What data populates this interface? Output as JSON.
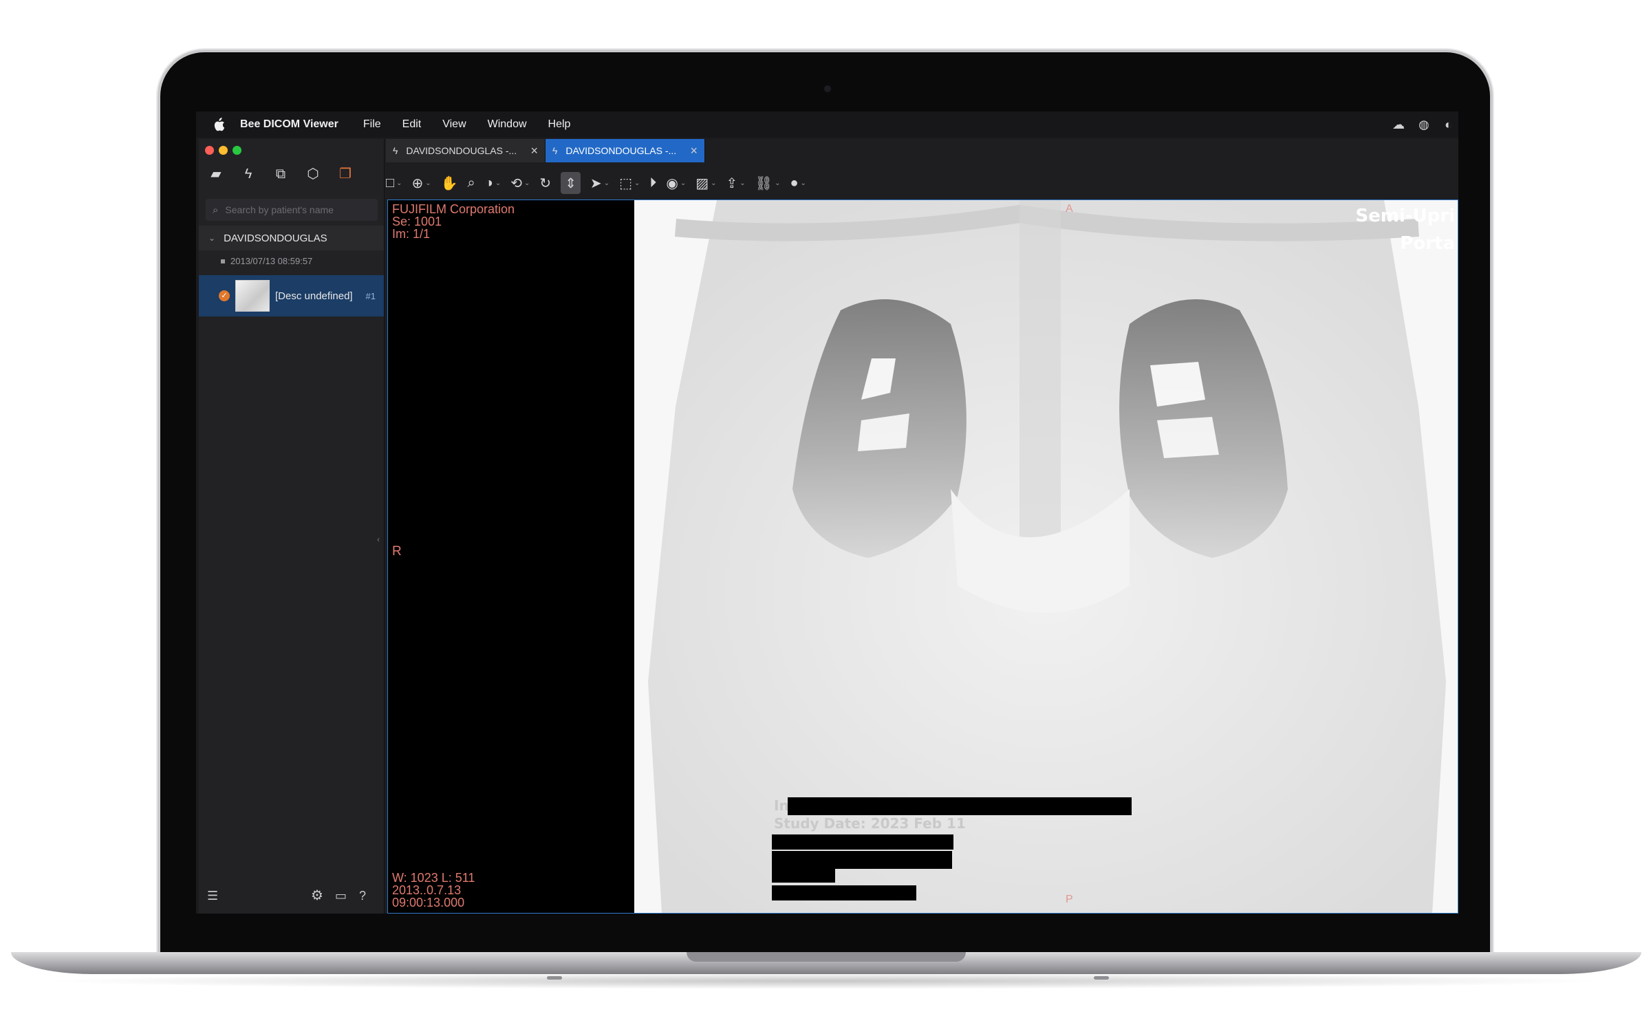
{
  "menubar": {
    "app_name": "Bee DICOM Viewer",
    "items": [
      "File",
      "Edit",
      "View",
      "Window",
      "Help"
    ],
    "tray_icons": [
      "bluetooth-icon",
      "globe-icon",
      "power-icon"
    ]
  },
  "sidebar": {
    "toolbar_icons": [
      "open-folder-icon",
      "lightning-icon",
      "grid-3d-icon",
      "cube-icon",
      "layers-icon"
    ],
    "search_placeholder": "Search by patient's name",
    "patient_name": "DAVIDSONDOUGLAS",
    "study_datetime": "2013/07/13 08:59:57",
    "series": {
      "description": "[Desc undefined]",
      "number": "#1"
    }
  },
  "tabs": [
    {
      "label": "DAVIDSONDOUGLAS -...",
      "active": false
    },
    {
      "label": "DAVIDSONDOUGLAS -...",
      "active": true
    }
  ],
  "toolbar_tools": [
    "select-rect-icon",
    "pan-icon",
    "hand-icon",
    "zoom-icon",
    "contrast-icon",
    "rotate-icon",
    "reset-icon",
    "scroll-stack-icon",
    "pointer-icon",
    "crop-icon",
    "play-icon",
    "eye-icon",
    "image-icon",
    "export-icon",
    "link-icon",
    "circle-icon"
  ],
  "viewer": {
    "manufacturer": "FUJIFILM Corporation",
    "series_label": "Se: 1001",
    "image_label": "Im: 1/1",
    "window_level": "W: 1023 L: 511",
    "date": "2013..0.7.13",
    "time": "09:00:13.000",
    "orientation": {
      "left": "R",
      "top": "A",
      "bottom": "P"
    },
    "burned_in": {
      "line1": "Semi-Upri",
      "line2": "Porta",
      "study_date": "Study Date: 2023 Feb 11",
      "prefix": "In"
    }
  }
}
